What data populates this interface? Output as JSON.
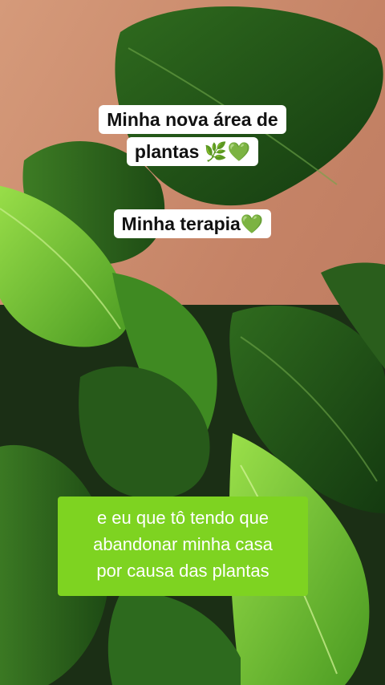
{
  "caption1": {
    "line1": "Minha nova área de",
    "line2": "plantas 🌿💚"
  },
  "caption2": {
    "text": "Minha terapia💚"
  },
  "caption3": {
    "line1": "e eu que tô tendo que",
    "line2": "abandonar minha casa",
    "line3": "por causa das plantas"
  },
  "colors": {
    "wall": "#c98a6a",
    "leaf_dark": "#1f4a16",
    "leaf_light": "#7ec93a",
    "caption_bg": "#ffffff",
    "highlight_bg": "#7ed321"
  }
}
